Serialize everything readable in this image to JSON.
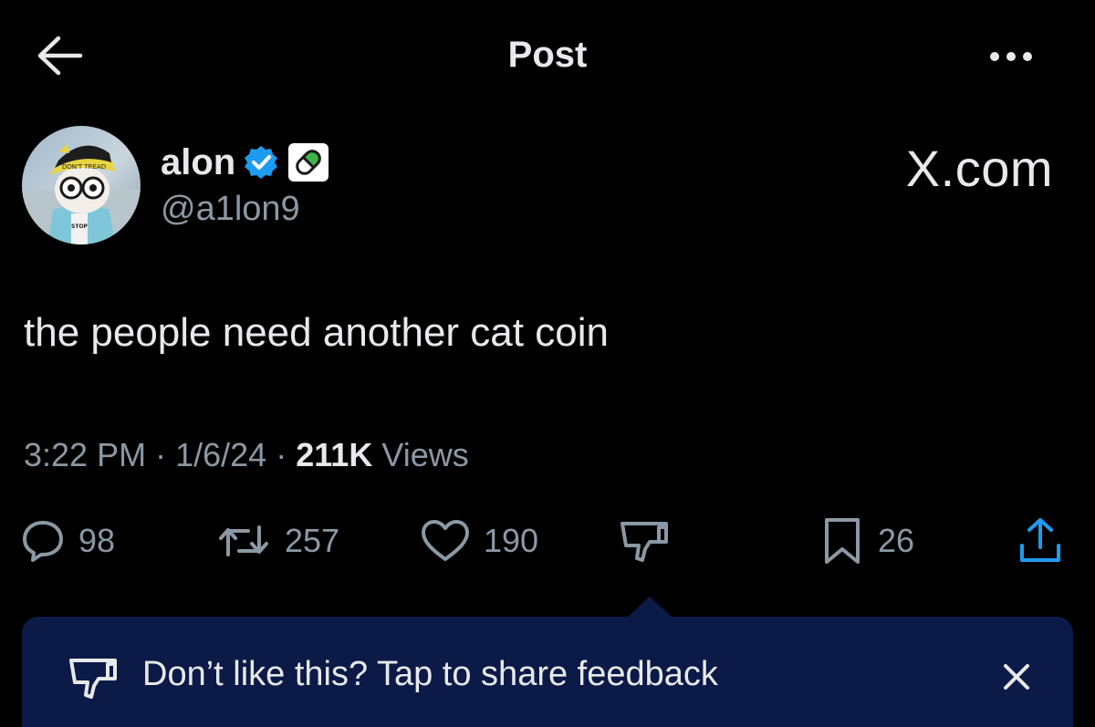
{
  "header": {
    "title": "Post",
    "back_icon": "arrow-left-icon",
    "more_icon": "more-horizontal-icon"
  },
  "author": {
    "name": "alon",
    "handle": "@a1lon9",
    "verified_icon": "verified-badge-icon",
    "affiliate_icon": "pill-badge-icon",
    "avatar_cap_text": "DON'T TREAD"
  },
  "watermark": "X.com",
  "post": {
    "text": "the people need another cat coin",
    "time": "3:22 PM",
    "date": "1/6/24",
    "views_count": "211K",
    "views_label": "Views",
    "separator": "·"
  },
  "actions": {
    "replies": "98",
    "reposts": "257",
    "likes": "190",
    "bookmarks": "26"
  },
  "feedback_toast": {
    "text": "Don’t like this? Tap to share feedback"
  },
  "colors": {
    "background": "#000000",
    "primary_text": "#e7e9ea",
    "secondary_text": "#8b98a5",
    "verified_blue": "#1d9bf0",
    "toast_background": "#0c1a48"
  }
}
